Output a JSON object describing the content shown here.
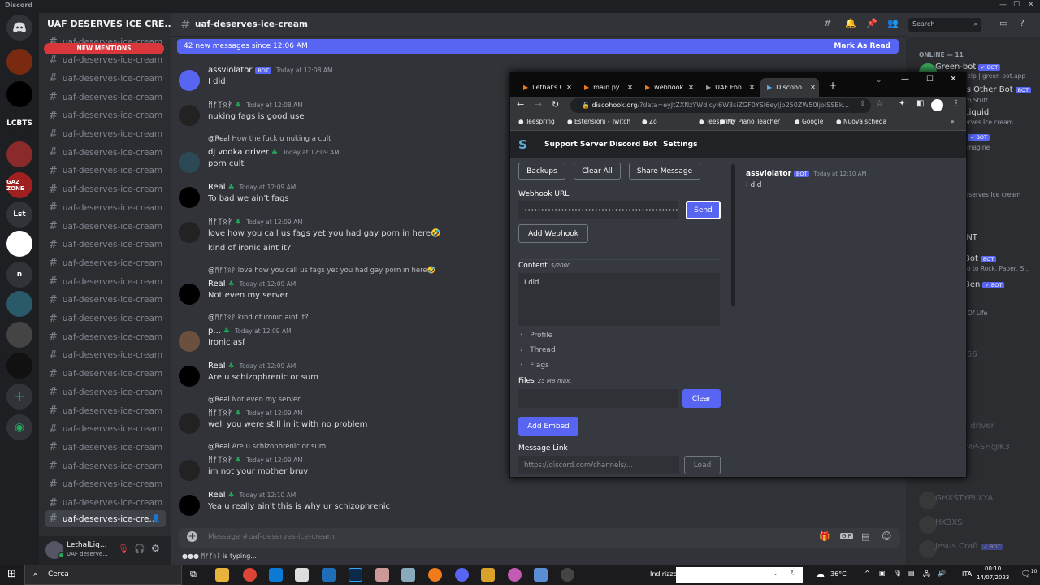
{
  "titlebar": {
    "app": "Discord"
  },
  "rail": {
    "servers": [
      "LCBTS",
      "GAZ ZONE",
      "Lst",
      "n"
    ]
  },
  "server": {
    "name": "UAF DESERVES ICE CRE...",
    "new_mentions": "NEW MENTIONS",
    "channels": [
      "uaf-deserves-ice-cream",
      "uaf-deserves-ice-cream",
      "uaf-deserves-ice-cream",
      "uaf-deserves-ice-cream",
      "uaf-deserves-ice-cream",
      "uaf-deserves-ice-cream",
      "uaf-deserves-ice-cream",
      "uaf-deserves-ice-cream",
      "uaf-deserves-ice-cream",
      "uaf-deserves-ice-cream",
      "uaf-deserves-ice-cream",
      "uaf-deserves-ice-cream",
      "uaf-deserves-ice-cream",
      "uaf-deserves-ice-cream",
      "uaf-deserves-ice-cream",
      "uaf-deserves-ice-cream",
      "uaf-deserves-ice-cream",
      "uaf-deserves-ice-cream",
      "uaf-deserves-ice-cream",
      "uaf-deserves-ice-cream",
      "uaf-deserves-ice-cream",
      "uaf-deserves-ice-cream",
      "uaf-deserves-ice-cream",
      "uaf-deserves-ice-cream",
      "uaf-deserves-ice-cream",
      "uaf-deserves-ice-cream"
    ],
    "selected_channel": "uaf-deserves-ice-cre..."
  },
  "user": {
    "name": "LethalLiq...",
    "status": "UAF deserve..."
  },
  "chat": {
    "channel": "uaf-deserves-ice-cream",
    "new_messages": "42 new messages since 12:06 AM",
    "mark_read": "Mark As Read",
    "placeholder": "Message #uaf-deserves-ice-cream",
    "typing": "ᛗᚠᛉᛟᚹ is typing...",
    "search": "Search",
    "messages": [
      {
        "author": "assviolator",
        "bot": "BOT",
        "time": "Today at 12:08 AM",
        "lines": [
          "I did"
        ]
      },
      {
        "author": "ᛗᚠᛉᛟᚹ",
        "time": "Today at 12:08 AM",
        "lines": [
          "nuking fags is good use"
        ]
      },
      {
        "reply_to": "@Real",
        "reply": "How the fuck u nuking a cult",
        "author": "dj vodka driver",
        "time": "Today at 12:09 AM",
        "lines": [
          "porn cult"
        ]
      },
      {
        "author": "Real",
        "time": "Today at 12:09 AM",
        "lines": [
          "To bad we ain't fags"
        ]
      },
      {
        "author": "ᛗᚠᛉᛟᚹ",
        "time": "Today at 12:09 AM",
        "lines": [
          "love how you call us fags yet you had gay porn in here🤣",
          "kind of ironic aint it?"
        ]
      },
      {
        "reply_to": "@ᛗᚠᛉᛟᚹ",
        "reply": "love how you call us fags yet you had gay porn in here🤣",
        "author": "Real",
        "time": "Today at 12:09 AM",
        "lines": [
          "Not even my server"
        ]
      },
      {
        "reply_to": "@ᛗᚠᛉᛟᚹ",
        "reply": "kind of ironic aint it?",
        "author": "p...",
        "time": "Today at 12:09 AM",
        "lines": [
          "Ironic asf"
        ]
      },
      {
        "author": "Real",
        "time": "Today at 12:09 AM",
        "lines": [
          "Are u schizophrenic or sum"
        ]
      },
      {
        "reply_to": "@Real",
        "reply": "Not even my server",
        "author": "ᛗᚠᛉᛟᚹ",
        "time": "Today at 12:09 AM",
        "lines": [
          "well you were still in it with no problem"
        ]
      },
      {
        "reply_to": "@Real",
        "reply": "Are u schizophrenic or sum",
        "author": "ᛗᚠᛉᛟᚹ",
        "time": "Today at 12:09 AM",
        "lines": [
          "im not your mother bruv"
        ]
      },
      {
        "author": "Real",
        "time": "Today at 12:10 AM",
        "lines": [
          "Yea u really ain't this is why ur schizophrenic"
        ]
      }
    ]
  },
  "members": {
    "header": "ONLINE — 11",
    "items": [
      {
        "text": "Green-bot",
        "bot": "✓ BOT"
      },
      {
        "text": "/help | green-bot.app",
        "small": true
      },
      {
        "text": "'s Other Bot",
        "bot": "BOT"
      },
      {
        "text": "to Stuff",
        "small": true
      },
      {
        "text": "Liquid"
      },
      {
        "text": "erves Ice cream.",
        "small": true
      },
      {
        "text": "",
        "bot": "✓ BOT"
      },
      {
        "text": "imagine",
        "small": true
      },
      {
        "text": "deserves Ice cream",
        "small": true
      },
      {
        "text": "ENT"
      },
      {
        "text": "Bot",
        "bot": "BOT"
      },
      {
        "text": "to to Rock, Paper, S...",
        "small": true
      },
      {
        "text": "Ben",
        "bot": "✓ BOT"
      },
      {
        "text": "y Of Life",
        "small": true
      },
      {
        "text": "66"
      },
      {
        "text": "a driver"
      },
      {
        "text": "MP-SH@K3"
      },
      {
        "text": "GHXSTYPLXYA"
      },
      {
        "text": "HK3XS"
      },
      {
        "text": "Jesus Craft",
        "bot": "✓ BOT"
      }
    ]
  },
  "browser": {
    "tabs": [
      "Lethal's C",
      "main.py -",
      "webhook",
      "UAF Fon",
      "Discoho"
    ],
    "url_host": "discohook.org",
    "url_rest": "/?data=eyJtZXNzYWdlcyI6W3siZGF0YSI6eyJjb250ZW50IjoiSSBk...",
    "bookmarks": [
      "Teespring",
      "Estensioni - Twitch",
      "Zo",
      "Teespring",
      "My Piano Teacher",
      "Google",
      "Nuova scheda"
    ],
    "nav": [
      "Support Server",
      "Discord Bot",
      "Settings"
    ],
    "editor": {
      "backups": "Backups",
      "clear_all": "Clear All",
      "share": "Share Message",
      "webhook_label": "Webhook URL",
      "webhook_value": "••••••••••••••••••••••••••••••••••••••••••••••",
      "send": "Send",
      "add_webhook": "Add Webhook",
      "content_label": "Content",
      "content_count": "5/2000",
      "content_value": "I did",
      "profile": "Profile",
      "thread": "Thread",
      "flags": "Flags",
      "files_label": "Files",
      "files_note": "25 MB max.",
      "clear": "Clear",
      "add_embed": "Add Embed",
      "link_label": "Message Link",
      "link_placeholder": "https://discord.com/channels/...",
      "load": "Load"
    },
    "preview": {
      "author": "assviolator",
      "bot": "BOT",
      "time": "Today at 12:10 AM",
      "text": "I did"
    }
  },
  "taskbar": {
    "search": "Cerca",
    "address_label": "Indirizzo",
    "weather": "36°C",
    "lang": "ITA",
    "time": "00:10",
    "date": "14/07/2023",
    "notifications": "10"
  },
  "colors": {
    "blurple": "#5865f2",
    "mention_red": "#da373c",
    "online_green": "#23a55a"
  }
}
